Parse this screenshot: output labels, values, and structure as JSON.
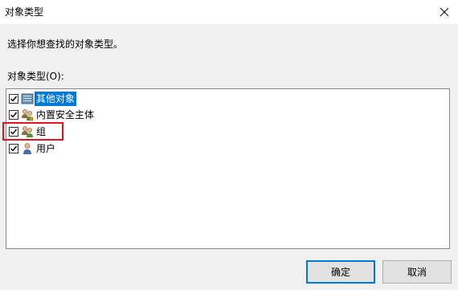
{
  "window": {
    "title": "对象类型"
  },
  "prompt": "选择你想查找的对象类型。",
  "list": {
    "label": "对象类型(O):",
    "items": [
      {
        "label": "其他对象",
        "checked": true,
        "icon": "folder-icon",
        "selected": true
      },
      {
        "label": "内置安全主体",
        "checked": true,
        "icon": "security-principal-icon",
        "selected": false
      },
      {
        "label": "组",
        "checked": true,
        "icon": "group-icon",
        "selected": false
      },
      {
        "label": "用户",
        "checked": true,
        "icon": "user-icon",
        "selected": false
      }
    ]
  },
  "buttons": {
    "ok": "确定",
    "cancel": "取消"
  },
  "colors": {
    "selection": "#0078d7",
    "highlight": "#e81123"
  }
}
